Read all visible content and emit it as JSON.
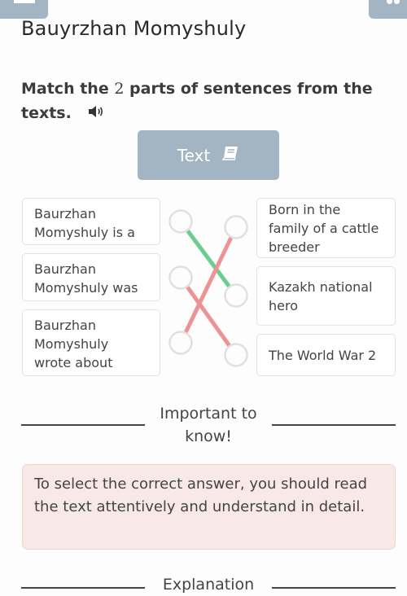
{
  "top_bar": {
    "left_button_icon": "menu-icon",
    "right_button_icon": "settings-icon"
  },
  "header": {
    "title": "Bauyrzhan Momyshuly"
  },
  "task": {
    "question_part1": "Match the ",
    "question_number": "2",
    "question_part2": " parts of sentences from the texts.",
    "audio_icon": "speaker-icon"
  },
  "text_button": {
    "label": "Text",
    "icon": "book-icon"
  },
  "matching": {
    "left_items": [
      "Baurzhan Momyshuly is a",
      "Baurzhan Momyshuly was",
      "Baurzhan Momyshuly wrote about"
    ],
    "right_items": [
      "Born in the family of a cattle breeder",
      "Kazakh national hero",
      "The World War 2"
    ],
    "connections": [
      {
        "from": 0,
        "to": 1,
        "status": "correct"
      },
      {
        "from": 1,
        "to": 2,
        "status": "incorrect"
      },
      {
        "from": 2,
        "to": 0,
        "status": "incorrect"
      }
    ],
    "colors": {
      "correct": "#6dcc8f",
      "incorrect": "#ee9393",
      "node_border": "#e0e0e0"
    }
  },
  "important": {
    "heading": "Important to know!",
    "text": "To select the correct answer, you should read the text attentively and understand in detail."
  },
  "explanation": {
    "heading": "Explanation"
  }
}
